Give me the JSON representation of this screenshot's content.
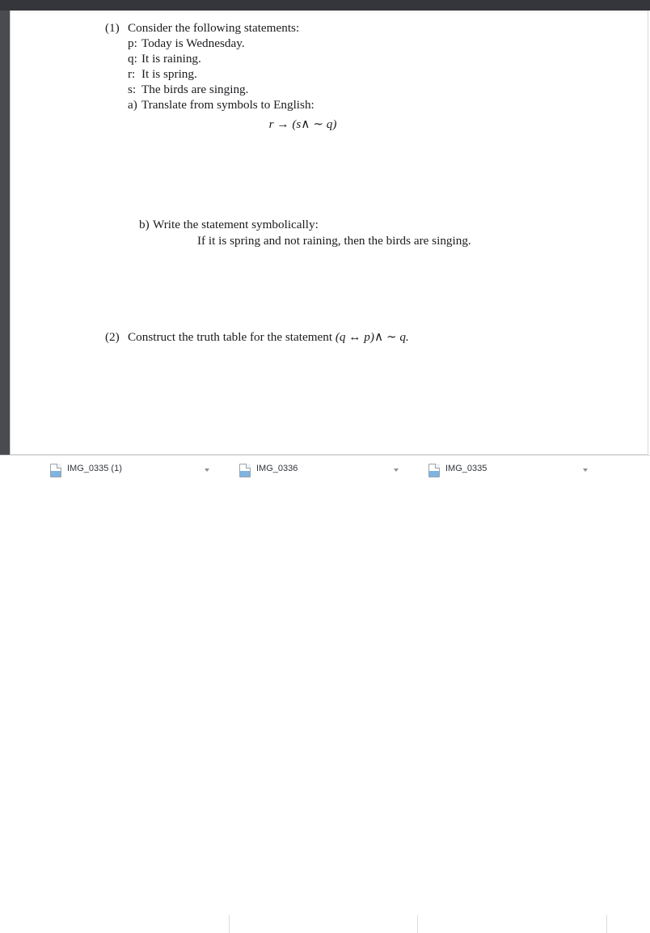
{
  "window": {
    "title": "Document viewer",
    "chrome_color": "#35363b",
    "rail_color": "#4a4b50",
    "page_background": "#ffffff",
    "text_color": "#1b1b1f"
  },
  "document": {
    "problems": [
      {
        "number": "(1)",
        "prompt": "Consider the following statements:",
        "definitions": [
          {
            "symbol": "p:",
            "text": "Today is Wednesday."
          },
          {
            "symbol": "q:",
            "text": "It is raining."
          },
          {
            "symbol": "r:",
            "text": "It is spring."
          },
          {
            "symbol": "s:",
            "text": "The birds are singing."
          }
        ],
        "parts": [
          {
            "label": "a)",
            "prompt": "Translate from symbols to English:",
            "formula": "r → (s∧ ∼ q)",
            "answer": ""
          },
          {
            "label": "b)",
            "prompt": "Write the statement symbolically:",
            "sentence": "If it is spring and not raining, then the birds are singing.",
            "answer": ""
          }
        ]
      },
      {
        "number": "(2)",
        "prompt": "Construct the truth table for the statement",
        "formula": "(q ↔ p)∧ ∼ q.",
        "answer": ""
      }
    ]
  },
  "download_shelf": {
    "items": [
      {
        "name": "IMG_0335 (1)",
        "icon": "image-file-icon"
      },
      {
        "name": "IMG_0336",
        "icon": "image-file-icon"
      },
      {
        "name": "IMG_0335",
        "icon": "image-file-icon"
      }
    ]
  }
}
